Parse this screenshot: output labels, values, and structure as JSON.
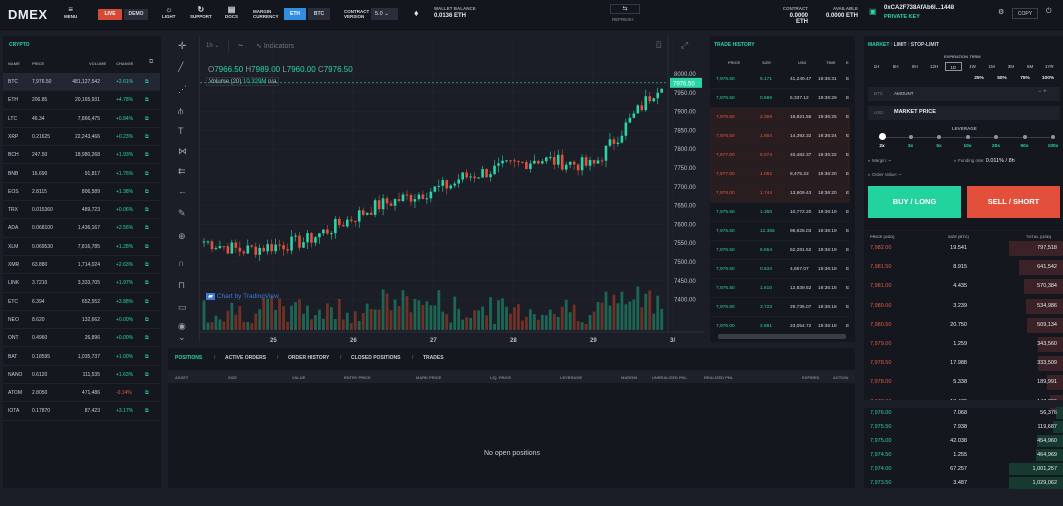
{
  "app": {
    "logo": "DMEX"
  },
  "toolbar": {
    "menu": "MENU",
    "live": "LIVE",
    "demo": "DEMO",
    "light": "LIGHT",
    "support": "SUPPORT",
    "docs": "DOCS",
    "margin_currency": "MARGIN CURRENCY",
    "eth": "ETH",
    "btc": "BTC",
    "contract_version": "CONTRACT VERSION",
    "version": "5.0",
    "wallet_balance_label": "WALLET BALANCE",
    "wallet_balance": "0.0136 ETH",
    "refresh": "REFRESH",
    "contract_label": "CONTRACT",
    "contract_value": "0.0000 ETH",
    "available_label": "AVAILABLE",
    "available_value": "0.0000 ETH",
    "address": "0xCA2F738AfAb6l...1448",
    "private_key": "PRIVATE KEY",
    "copy": "COPY"
  },
  "crypto": {
    "title": "CRYPTO",
    "cols": [
      "NAME",
      "PRICE",
      "VOLUME",
      "CHANGE"
    ],
    "rows": [
      [
        "BTC",
        "7,976.50",
        "481,127,542",
        "+2.61%",
        "g"
      ],
      [
        "ETH",
        "206.85",
        "20,165,931",
        "+4.78%",
        "g"
      ],
      [
        "LTC",
        "46.34",
        "7,866,475",
        "+0.84%",
        "g"
      ],
      [
        "XRP",
        "0.21625",
        "22,243,466",
        "+0.23%",
        "g"
      ],
      [
        "BCH",
        "247.50",
        "18,980,268",
        "+1.93%",
        "g"
      ],
      [
        "BNB",
        "16.690",
        "91,817",
        "+1.76%",
        "g"
      ],
      [
        "EOS",
        "2.8115",
        "806,589",
        "+1.38%",
        "g"
      ],
      [
        "TRX",
        "0.015360",
        "489,723",
        "+0.06%",
        "g"
      ],
      [
        "ADA",
        "0.068100",
        "1,436,167",
        "+2.56%",
        "g"
      ],
      [
        "XLM",
        "0.069530",
        "7,816,785",
        "+1.28%",
        "g"
      ],
      [
        "XMR",
        "63.880",
        "1,714,024",
        "+2.63%",
        "g"
      ],
      [
        "LINK",
        "3.7210",
        "3,333,705",
        "+1.97%",
        "g"
      ],
      [
        "ETC",
        "6.394",
        "652,552",
        "+3.88%",
        "g"
      ],
      [
        "NEO",
        "8.620",
        "132,662",
        "+0.00%",
        "g"
      ],
      [
        "ONT",
        "0.4960",
        "26,896",
        "+0.00%",
        "g"
      ],
      [
        "BAT",
        "0.18595",
        "1,035,737",
        "+1.00%",
        "g"
      ],
      [
        "NANO",
        "0.6120",
        "111,535",
        "+1.63%",
        "g"
      ],
      [
        "ATOM",
        "2.8050",
        "471,486",
        "-0.14%",
        "r"
      ],
      [
        "IOTA",
        "0.17870",
        "87,423",
        "+3.17%",
        "g"
      ]
    ]
  },
  "chart": {
    "interval": "1h",
    "indicators": "Indicators",
    "o_label": "O",
    "o": "7966.50",
    "h_label": "H",
    "h": "7989.00",
    "l_label": "L",
    "l": "7960.00",
    "c_label": "C",
    "c": "7976.50",
    "volume_label": "Volume (20)",
    "volume_val": "10.329M",
    "volume_na": "n/a",
    "watermark": "Chart by TradingView",
    "last_price": "7976.50",
    "y_ticks": [
      "8000.00",
      "7950.00",
      "7900.00",
      "7850.00",
      "7800.00",
      "7750.00",
      "7700.00",
      "7650.00",
      "7600.00",
      "7550.00",
      "7500.00",
      "7450.00",
      "7400.00"
    ],
    "x_ticks": [
      "25",
      "26",
      "27",
      "28",
      "29",
      "3("
    ]
  },
  "trade_history": {
    "title": "TRADE HISTORY",
    "cols": [
      "PRICE",
      "SIZE",
      "USD",
      "TIME",
      "E"
    ],
    "rows": [
      [
        "7,976.50",
        "5.171",
        "41,249.47",
        "19:36:31",
        "g"
      ],
      [
        "7,976.50",
        "0.669",
        "5,337.12",
        "19:36:29",
        "g"
      ],
      [
        "7,976.50",
        "2.359",
        "18,821.56",
        "19:36:25",
        "r"
      ],
      [
        "7,976.50",
        "1.804",
        "14,392.32",
        "19:36:24",
        "r"
      ],
      [
        "7,977.00",
        "5.074",
        "40,482.37",
        "19:36:22",
        "r"
      ],
      [
        "7,977.00",
        "1.062",
        "8,475.22",
        "19:36:20",
        "r"
      ],
      [
        "7,978.00",
        "1.744",
        "13,909.43",
        "19:36:20",
        "r"
      ],
      [
        "7,975.50",
        "1.350",
        "10,772.20",
        "19:36:19",
        "g"
      ],
      [
        "7,975.50",
        "12.366",
        "98,625.03",
        "19:36:19",
        "g"
      ],
      [
        "7,976.50",
        "6.554",
        "52,281.52",
        "19:36:19",
        "g"
      ],
      [
        "7,976.50",
        "0.634",
        "4,657.07",
        "19:36:18",
        "g"
      ],
      [
        "7,976.50",
        "1.610",
        "12,839.52",
        "19:36:18",
        "g"
      ],
      [
        "7,976.50",
        "3.723",
        "29,735.07",
        "19:36:18",
        "g"
      ],
      [
        "7,976.00",
        "2.891",
        "23,054.72",
        "19:36:18",
        "g"
      ]
    ]
  },
  "order": {
    "tabs": [
      "MARKET",
      "LIMIT",
      "STOP-LIMIT"
    ],
    "expiration_label": "EXPIRATION TERM",
    "expiration": [
      "1H",
      "6H",
      "8H",
      "12H",
      "1D",
      "1W",
      "1M",
      "3M",
      "6M",
      "1YR"
    ],
    "pct": [
      "25%",
      "50%",
      "75%",
      "100%"
    ],
    "btc_label": "BTC",
    "amount_label": "AMOUNT",
    "usd_label": "USD",
    "market_price": "MARKET PRICE",
    "leverage_label": "LEVERAGE",
    "leverage": [
      "2x",
      "3x",
      "5x",
      "10x",
      "20x",
      "50x",
      "100x"
    ],
    "margin_label": "Margin:",
    "margin_val": "--",
    "funding_label": "Funding rate:",
    "funding_val": "0.011% / 8h",
    "order_value_label": "Order Value:",
    "order_value_val": "--",
    "buy": "BUY / LONG",
    "sell": "SELL / SHORT"
  },
  "orderbook": {
    "cols": [
      "PRICE (USD)",
      "SIZE (BTC)",
      "TOTAL (USD)"
    ],
    "asks": [
      [
        "7,982.00",
        "19.541",
        "797,518",
        1.0
      ],
      [
        "7,981.50",
        "8.915",
        "641,542",
        0.8
      ],
      [
        "7,981.00",
        "4.435",
        "570,384",
        0.71
      ],
      [
        "7,980.00",
        "3.239",
        "534,986",
        0.67
      ],
      [
        "7,980.50",
        "20.750",
        "509,134",
        0.64
      ],
      [
        "7,979.00",
        "1.259",
        "343,560",
        0.43
      ],
      [
        "7,978.50",
        "17.988",
        "333,509",
        0.42
      ],
      [
        "7,978.00",
        "5.338",
        "189,991",
        0.24
      ],
      [
        "7,977.00",
        "18.478",
        "147,399",
        0.18
      ]
    ],
    "bids": [
      [
        "7,976.00",
        "7.068",
        "56,376",
        0.06
      ],
      [
        "7,975.50",
        "7.938",
        "119,687",
        0.12
      ],
      [
        "7,975.00",
        "42.038",
        "454,960",
        0.45
      ],
      [
        "7,974.50",
        "1.255",
        "464,969",
        0.46
      ],
      [
        "7,974.00",
        "67.257",
        "1,001,257",
        1.0
      ],
      [
        "7,973.50",
        "3.487",
        "1,029,062",
        1.0
      ]
    ]
  },
  "positions": {
    "tabs": [
      "POSITIONS",
      "ACTIVE ORDERS",
      "ORDER HISTORY",
      "CLOSED POSITIONS",
      "TRADES"
    ],
    "cols": [
      "ASSET",
      "SIZE",
      "VALUE",
      "ENTRY PRICE",
      "MARK PRICE",
      "LIQ. PRICE",
      "LEVERAGE",
      "MARGIN",
      "UNREALIZED PNL",
      "REALIZED PNL",
      "EXPIRES",
      "ACTION"
    ],
    "empty": "No open positions"
  },
  "colors": {
    "green": "#2bd4a7",
    "red": "#e25a48",
    "bg": "#1b1e27"
  }
}
